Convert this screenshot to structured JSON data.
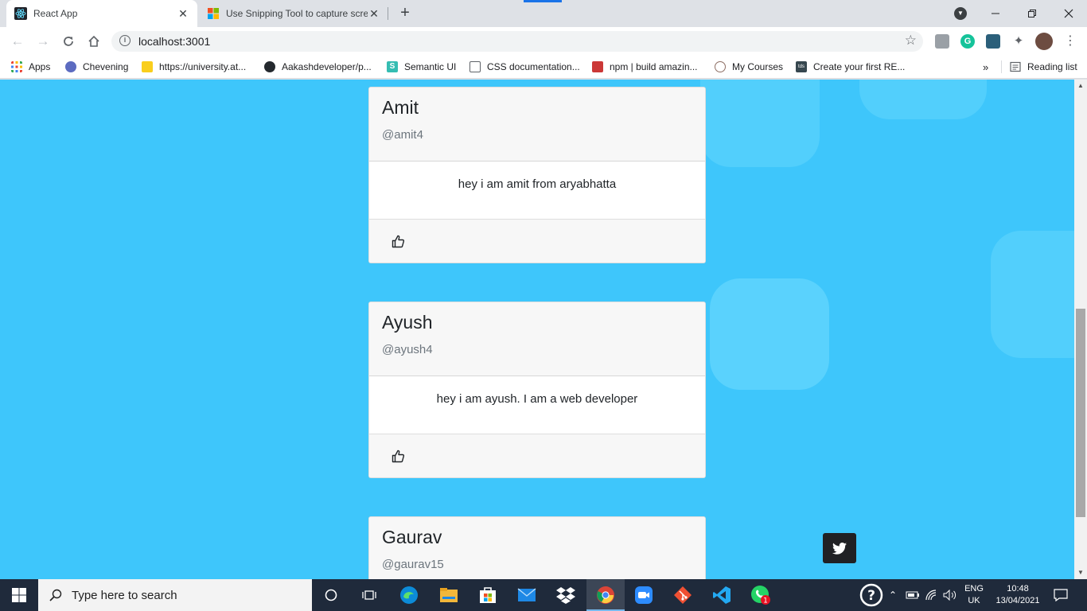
{
  "browser": {
    "tabs": [
      {
        "title": "React App",
        "active": true,
        "icon": "react-icon"
      },
      {
        "title": "Use Snipping Tool to capture scre",
        "active": false,
        "icon": "microsoft-icon"
      }
    ],
    "address": "localhost:3001",
    "bookmarks": [
      {
        "label": "Apps",
        "icon": "apps-grid-icon"
      },
      {
        "label": "Chevening",
        "icon": "chevening-icon"
      },
      {
        "label": "https://university.at...",
        "icon": "folder-icon"
      },
      {
        "label": "Aakashdeveloper/p...",
        "icon": "github-icon"
      },
      {
        "label": "Semantic UI",
        "icon": "semantic-ui-icon"
      },
      {
        "label": "CSS documentation...",
        "icon": "css-doc-icon"
      },
      {
        "label": "npm | build amazin...",
        "icon": "npm-icon"
      },
      {
        "label": "My Courses",
        "icon": "courses-icon"
      },
      {
        "label": "Create your first RE...",
        "icon": "tds-icon"
      }
    ],
    "overflow_label": "»",
    "reading_list": "Reading list"
  },
  "cards": [
    {
      "name": "Amit",
      "handle": "@amit4",
      "message": "hey i am amit from aryabhatta"
    },
    {
      "name": "Ayush",
      "handle": "@ayush4",
      "message": "hey i am ayush. I am a web developer"
    },
    {
      "name": "Gaurav",
      "handle": "@gaurav15",
      "message": ""
    }
  ],
  "taskbar": {
    "search_placeholder": "Type here to search",
    "language": "ENG",
    "region": "UK",
    "time": "10:48",
    "date": "13/04/2021",
    "whatsapp_badge": "1"
  },
  "colors": {
    "page_background": "#3ec6fb",
    "card_header": "#f7f7f7",
    "taskbar": "#1f2a3b",
    "twitter_button": "#202124"
  }
}
